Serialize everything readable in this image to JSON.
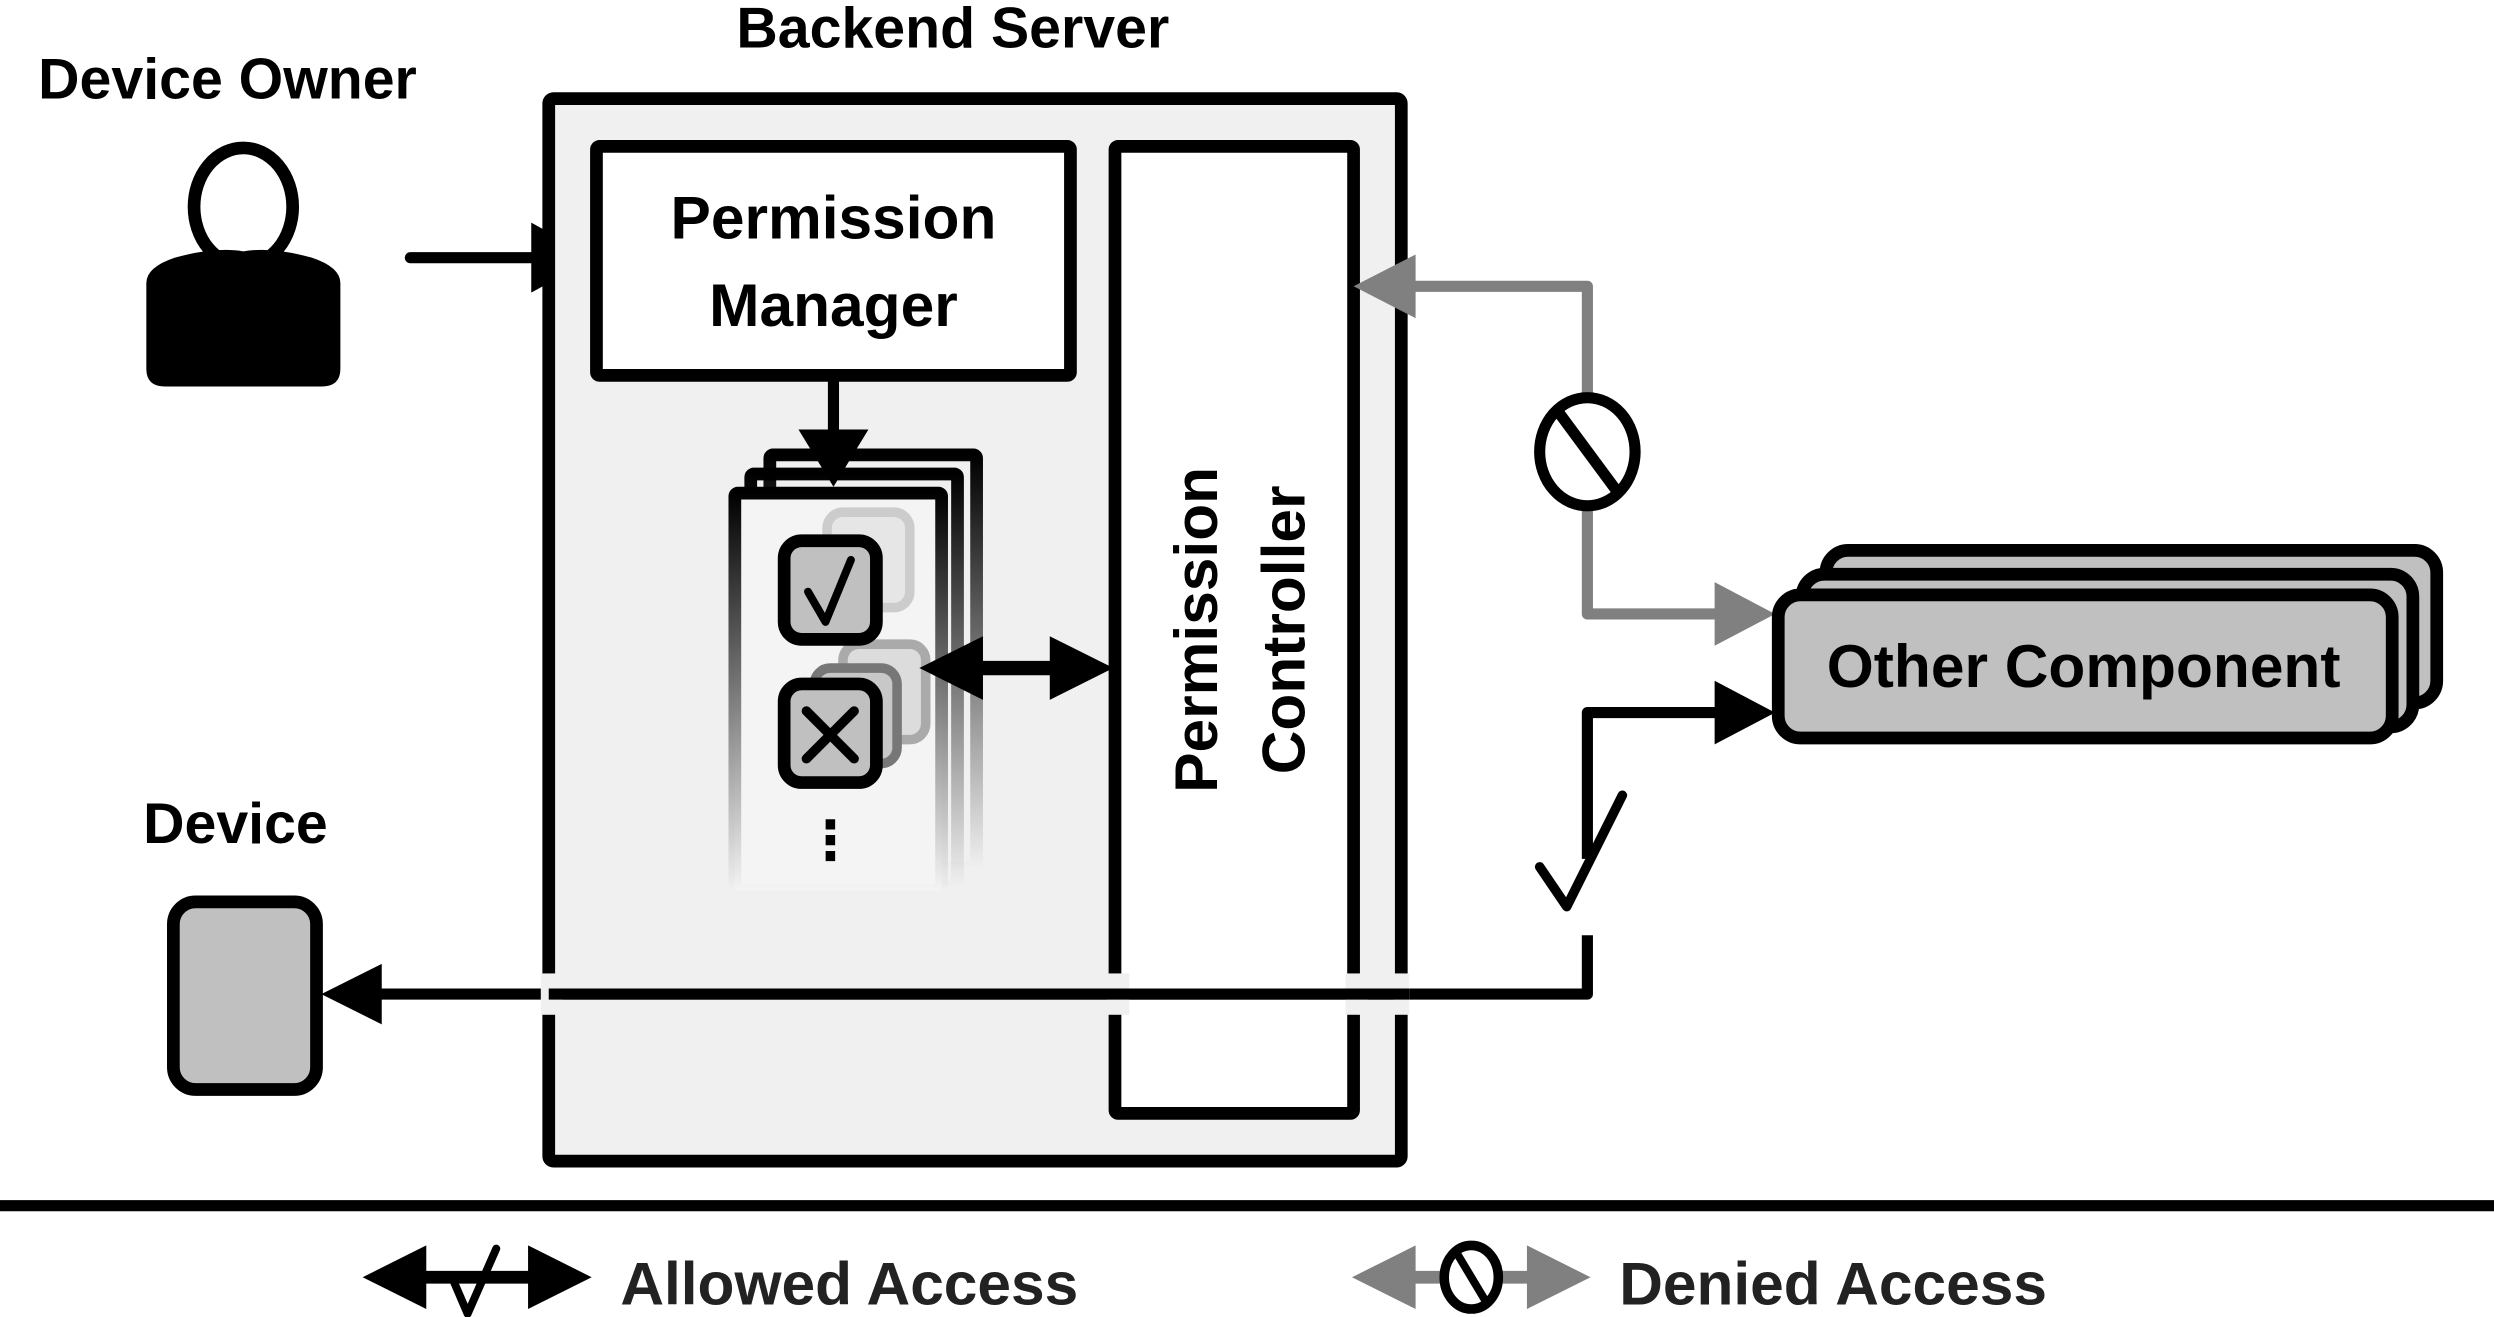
{
  "labels": {
    "device_owner": "Device Owner",
    "backend_server": "Backend Server",
    "permission_manager_line1": "Permission",
    "permission_manager_line2": "Manager",
    "permission_controller_line1": "Permission",
    "permission_controller_line2": "Controller",
    "device": "Device",
    "other_component": "Other Component",
    "ellipsis": "⋮"
  },
  "legend": {
    "allowed": "Allowed Access",
    "denied": "Denied Access"
  },
  "icons": {
    "user": "user-icon",
    "check": "check-icon",
    "cross": "cross-icon",
    "prohibited": "prohibited-icon"
  },
  "colors": {
    "allowed": "#000000",
    "denied": "#808080",
    "server_fill": "#f0f0f0",
    "component_fill": "#c0c0c0"
  }
}
